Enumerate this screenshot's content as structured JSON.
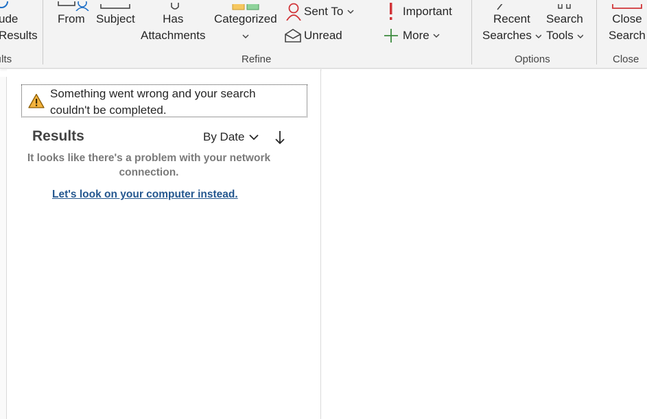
{
  "ribbon": {
    "include_results": {
      "line1": "ude",
      "line2": "Results"
    },
    "from": {
      "label": "From"
    },
    "subject": {
      "label": "Subject"
    },
    "has_attachments": {
      "line1": "Has",
      "line2": "Attachments"
    },
    "categorized": {
      "label": "Categorized"
    },
    "sent_to": {
      "label": "Sent To"
    },
    "unread": {
      "label": "Unread"
    },
    "important": {
      "label": "Important"
    },
    "more": {
      "label": "More"
    },
    "recent_searches": {
      "line1": "Recent",
      "line2": "Searches"
    },
    "search_tools": {
      "line1": "Search",
      "line2": "Tools"
    },
    "close_search": {
      "line1": "Close",
      "line2": "Search"
    },
    "groups": {
      "results": "ılts",
      "refine": "Refine",
      "options": "Options",
      "close": "Close"
    }
  },
  "error": {
    "line1": "Something went wrong and your search",
    "line2": "couldn't be completed."
  },
  "results": {
    "title": "Results",
    "sort_label": "By Date",
    "message_line1": "It looks like there's a problem with your network",
    "message_line2": "connection.",
    "link": "Let's look on your computer instead."
  },
  "colors": {
    "ribbon_bg": "#f3f3f3",
    "link": "#24578f",
    "warning": "#e8a317",
    "important": "#d13438",
    "more_plus": "#3b8a3e",
    "sent_to_icon": "#d13438",
    "close_icon": "#d13438"
  },
  "icons": {
    "from": "person-icon",
    "subject": "subject-icon",
    "has_attachments": "paperclip-icon",
    "categorized": "category-icon",
    "sent_to": "person-outline-icon",
    "unread": "open-envelope-icon",
    "important": "exclamation-icon",
    "more": "plus-icon",
    "warning": "warning-icon",
    "sort": "arrow-down-icon"
  }
}
